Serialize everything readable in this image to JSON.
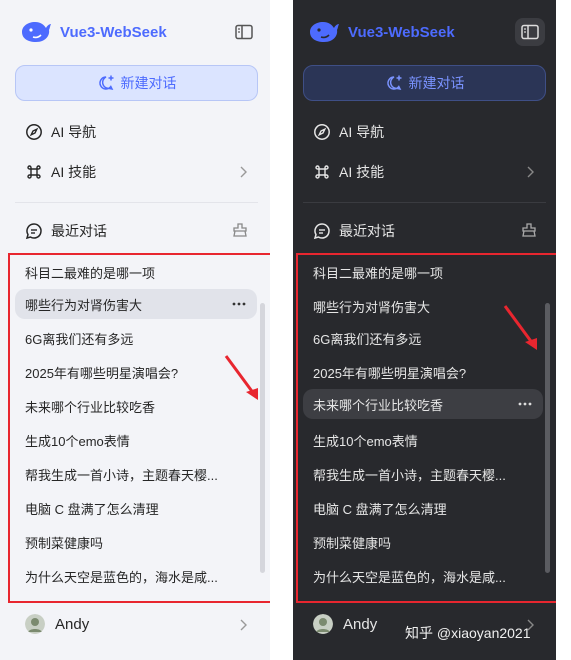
{
  "app": {
    "title": "Vue3-WebSeek"
  },
  "sidebar": {
    "new_chat_label": "新建对话",
    "nav": [
      {
        "label": "AI 导航",
        "icon": "compass-icon"
      },
      {
        "label": "AI 技能",
        "icon": "command-icon"
      }
    ],
    "recent_label": "最近对话",
    "conversations": [
      "科目二最难的是哪一项",
      "哪些行为对肾伤害大",
      "6G离我们还有多远",
      "2025年有哪些明星演唱会?",
      "未来哪个行业比较吃香",
      "生成10个emo表情",
      "帮我生成一首小诗，主题春天樱...",
      "电脑 C 盘满了怎么清理",
      "预制菜健康吗",
      "为什么天空是蓝色的，海水是咸..."
    ],
    "user_name": "Andy"
  },
  "themes": {
    "light": {
      "active_index": 1,
      "accent": "#4d6bfe",
      "background": "#f3f4f8"
    },
    "dark": {
      "active_index": 4,
      "accent": "#4d6bfe",
      "background": "#28292d"
    }
  },
  "annotation": {
    "highlight_color": "#e8262f"
  },
  "watermark": "知乎 @xiaoyan2021"
}
